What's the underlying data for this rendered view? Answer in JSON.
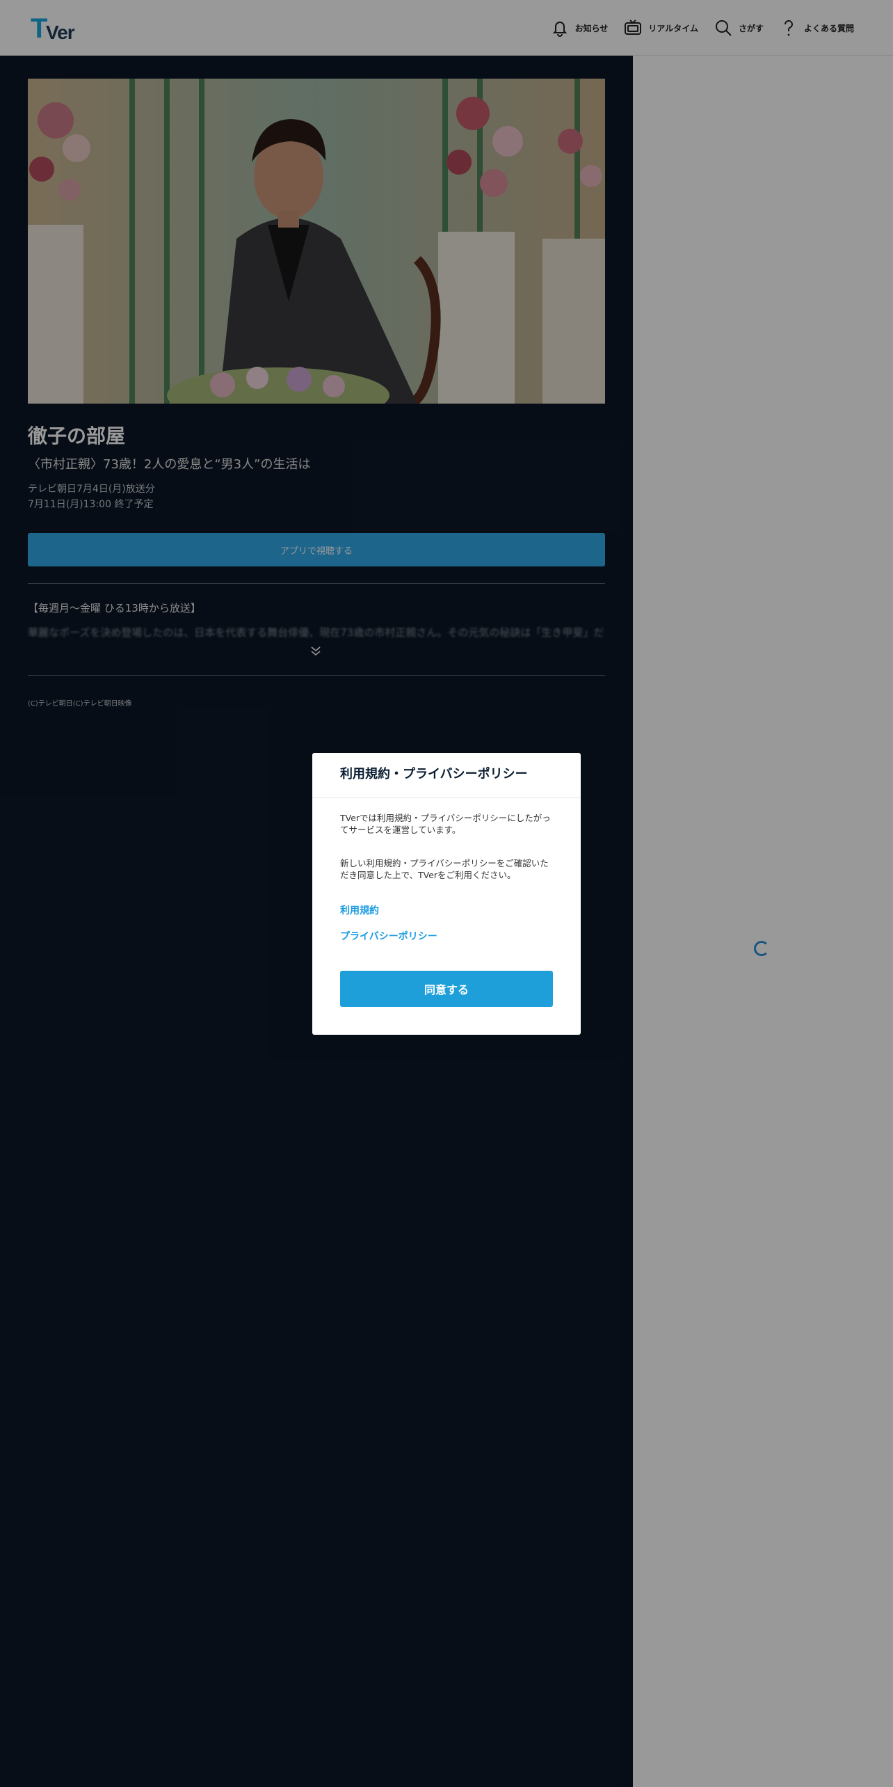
{
  "header": {
    "logo_text_t": "T",
    "logo_text_ver": "Ver",
    "nav": [
      {
        "label": "お知らせ",
        "icon": "bell-icon"
      },
      {
        "label": "リアルタイム",
        "icon": "tv-icon"
      },
      {
        "label": "さがす",
        "icon": "search-icon"
      },
      {
        "label": "よくある質問",
        "icon": "question-icon"
      }
    ]
  },
  "episode": {
    "title": "徹子の部屋",
    "subtitle": "〈市村正親〉73歳！2人の愛息と“男3人”の生活は",
    "broadcast": "テレビ朝日7月4日(月)放送分",
    "expiry": "7月11日(月)13:00 終了予定",
    "app_button": "アプリで視聴する",
    "description_head": "【毎週月～金曜 ひる13時から放送】",
    "description_body": "華麗なポーズを決め登場したのは、日本を代表する舞台俳優、現在73歳の市村正親さん。その元気の秘訣は「生き甲斐」だ",
    "copyright": "(C)テレビ朝日(C)テレビ朝日映像"
  },
  "modal": {
    "title": "利用規約・プライバシーポリシー",
    "para1": "TVerでは利用規約・プライバシーポリシーにしたがってサービスを運営しています。",
    "para2": "新しい利用規約・プライバシーポリシーをご確認いただき同意した上で、TVerをご利用ください。",
    "link_terms": "利用規約",
    "link_privacy": "プライバシーポリシー",
    "agree_button": "同意する"
  },
  "colors": {
    "brand_blue": "#1f9fd9",
    "main_bg": "#0d1726",
    "overlay": "rgba(0,0,0,0.4)"
  }
}
